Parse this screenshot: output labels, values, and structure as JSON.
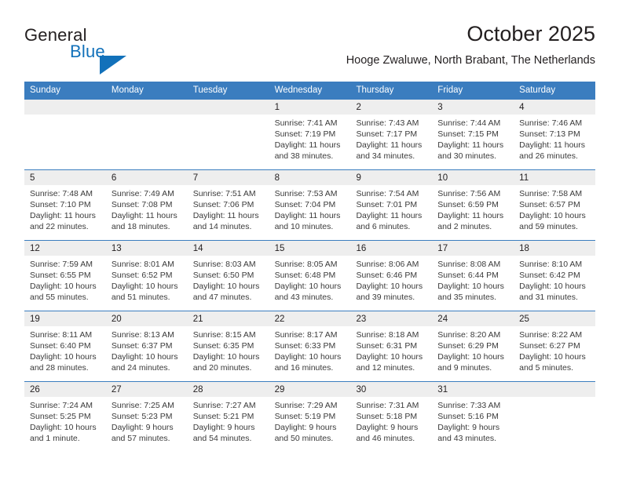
{
  "brand": {
    "word_one": "General",
    "word_two": "Blue",
    "triangle_color": "#1271ba",
    "text_color": "#231f20"
  },
  "header": {
    "month_title": "October 2025",
    "location": "Hooge Zwaluwe, North Brabant, The Netherlands"
  },
  "theme": {
    "header_blue": "#3b7dbf",
    "day_band_gray": "#eeeeee",
    "text_dark": "#231f20",
    "text_body": "#3a3a3a"
  },
  "weekdays": [
    "Sunday",
    "Monday",
    "Tuesday",
    "Wednesday",
    "Thursday",
    "Friday",
    "Saturday"
  ],
  "weeks": [
    [
      {
        "day": "",
        "sunrise": "",
        "sunset": "",
        "daylight_line1": "",
        "daylight_line2": ""
      },
      {
        "day": "",
        "sunrise": "",
        "sunset": "",
        "daylight_line1": "",
        "daylight_line2": ""
      },
      {
        "day": "",
        "sunrise": "",
        "sunset": "",
        "daylight_line1": "",
        "daylight_line2": ""
      },
      {
        "day": "1",
        "sunrise": "Sunrise: 7:41 AM",
        "sunset": "Sunset: 7:19 PM",
        "daylight_line1": "Daylight: 11 hours",
        "daylight_line2": "and 38 minutes."
      },
      {
        "day": "2",
        "sunrise": "Sunrise: 7:43 AM",
        "sunset": "Sunset: 7:17 PM",
        "daylight_line1": "Daylight: 11 hours",
        "daylight_line2": "and 34 minutes."
      },
      {
        "day": "3",
        "sunrise": "Sunrise: 7:44 AM",
        "sunset": "Sunset: 7:15 PM",
        "daylight_line1": "Daylight: 11 hours",
        "daylight_line2": "and 30 minutes."
      },
      {
        "day": "4",
        "sunrise": "Sunrise: 7:46 AM",
        "sunset": "Sunset: 7:13 PM",
        "daylight_line1": "Daylight: 11 hours",
        "daylight_line2": "and 26 minutes."
      }
    ],
    [
      {
        "day": "5",
        "sunrise": "Sunrise: 7:48 AM",
        "sunset": "Sunset: 7:10 PM",
        "daylight_line1": "Daylight: 11 hours",
        "daylight_line2": "and 22 minutes."
      },
      {
        "day": "6",
        "sunrise": "Sunrise: 7:49 AM",
        "sunset": "Sunset: 7:08 PM",
        "daylight_line1": "Daylight: 11 hours",
        "daylight_line2": "and 18 minutes."
      },
      {
        "day": "7",
        "sunrise": "Sunrise: 7:51 AM",
        "sunset": "Sunset: 7:06 PM",
        "daylight_line1": "Daylight: 11 hours",
        "daylight_line2": "and 14 minutes."
      },
      {
        "day": "8",
        "sunrise": "Sunrise: 7:53 AM",
        "sunset": "Sunset: 7:04 PM",
        "daylight_line1": "Daylight: 11 hours",
        "daylight_line2": "and 10 minutes."
      },
      {
        "day": "9",
        "sunrise": "Sunrise: 7:54 AM",
        "sunset": "Sunset: 7:01 PM",
        "daylight_line1": "Daylight: 11 hours",
        "daylight_line2": "and 6 minutes."
      },
      {
        "day": "10",
        "sunrise": "Sunrise: 7:56 AM",
        "sunset": "Sunset: 6:59 PM",
        "daylight_line1": "Daylight: 11 hours",
        "daylight_line2": "and 2 minutes."
      },
      {
        "day": "11",
        "sunrise": "Sunrise: 7:58 AM",
        "sunset": "Sunset: 6:57 PM",
        "daylight_line1": "Daylight: 10 hours",
        "daylight_line2": "and 59 minutes."
      }
    ],
    [
      {
        "day": "12",
        "sunrise": "Sunrise: 7:59 AM",
        "sunset": "Sunset: 6:55 PM",
        "daylight_line1": "Daylight: 10 hours",
        "daylight_line2": "and 55 minutes."
      },
      {
        "day": "13",
        "sunrise": "Sunrise: 8:01 AM",
        "sunset": "Sunset: 6:52 PM",
        "daylight_line1": "Daylight: 10 hours",
        "daylight_line2": "and 51 minutes."
      },
      {
        "day": "14",
        "sunrise": "Sunrise: 8:03 AM",
        "sunset": "Sunset: 6:50 PM",
        "daylight_line1": "Daylight: 10 hours",
        "daylight_line2": "and 47 minutes."
      },
      {
        "day": "15",
        "sunrise": "Sunrise: 8:05 AM",
        "sunset": "Sunset: 6:48 PM",
        "daylight_line1": "Daylight: 10 hours",
        "daylight_line2": "and 43 minutes."
      },
      {
        "day": "16",
        "sunrise": "Sunrise: 8:06 AM",
        "sunset": "Sunset: 6:46 PM",
        "daylight_line1": "Daylight: 10 hours",
        "daylight_line2": "and 39 minutes."
      },
      {
        "day": "17",
        "sunrise": "Sunrise: 8:08 AM",
        "sunset": "Sunset: 6:44 PM",
        "daylight_line1": "Daylight: 10 hours",
        "daylight_line2": "and 35 minutes."
      },
      {
        "day": "18",
        "sunrise": "Sunrise: 8:10 AM",
        "sunset": "Sunset: 6:42 PM",
        "daylight_line1": "Daylight: 10 hours",
        "daylight_line2": "and 31 minutes."
      }
    ],
    [
      {
        "day": "19",
        "sunrise": "Sunrise: 8:11 AM",
        "sunset": "Sunset: 6:40 PM",
        "daylight_line1": "Daylight: 10 hours",
        "daylight_line2": "and 28 minutes."
      },
      {
        "day": "20",
        "sunrise": "Sunrise: 8:13 AM",
        "sunset": "Sunset: 6:37 PM",
        "daylight_line1": "Daylight: 10 hours",
        "daylight_line2": "and 24 minutes."
      },
      {
        "day": "21",
        "sunrise": "Sunrise: 8:15 AM",
        "sunset": "Sunset: 6:35 PM",
        "daylight_line1": "Daylight: 10 hours",
        "daylight_line2": "and 20 minutes."
      },
      {
        "day": "22",
        "sunrise": "Sunrise: 8:17 AM",
        "sunset": "Sunset: 6:33 PM",
        "daylight_line1": "Daylight: 10 hours",
        "daylight_line2": "and 16 minutes."
      },
      {
        "day": "23",
        "sunrise": "Sunrise: 8:18 AM",
        "sunset": "Sunset: 6:31 PM",
        "daylight_line1": "Daylight: 10 hours",
        "daylight_line2": "and 12 minutes."
      },
      {
        "day": "24",
        "sunrise": "Sunrise: 8:20 AM",
        "sunset": "Sunset: 6:29 PM",
        "daylight_line1": "Daylight: 10 hours",
        "daylight_line2": "and 9 minutes."
      },
      {
        "day": "25",
        "sunrise": "Sunrise: 8:22 AM",
        "sunset": "Sunset: 6:27 PM",
        "daylight_line1": "Daylight: 10 hours",
        "daylight_line2": "and 5 minutes."
      }
    ],
    [
      {
        "day": "26",
        "sunrise": "Sunrise: 7:24 AM",
        "sunset": "Sunset: 5:25 PM",
        "daylight_line1": "Daylight: 10 hours",
        "daylight_line2": "and 1 minute."
      },
      {
        "day": "27",
        "sunrise": "Sunrise: 7:25 AM",
        "sunset": "Sunset: 5:23 PM",
        "daylight_line1": "Daylight: 9 hours",
        "daylight_line2": "and 57 minutes."
      },
      {
        "day": "28",
        "sunrise": "Sunrise: 7:27 AM",
        "sunset": "Sunset: 5:21 PM",
        "daylight_line1": "Daylight: 9 hours",
        "daylight_line2": "and 54 minutes."
      },
      {
        "day": "29",
        "sunrise": "Sunrise: 7:29 AM",
        "sunset": "Sunset: 5:19 PM",
        "daylight_line1": "Daylight: 9 hours",
        "daylight_line2": "and 50 minutes."
      },
      {
        "day": "30",
        "sunrise": "Sunrise: 7:31 AM",
        "sunset": "Sunset: 5:18 PM",
        "daylight_line1": "Daylight: 9 hours",
        "daylight_line2": "and 46 minutes."
      },
      {
        "day": "31",
        "sunrise": "Sunrise: 7:33 AM",
        "sunset": "Sunset: 5:16 PM",
        "daylight_line1": "Daylight: 9 hours",
        "daylight_line2": "and 43 minutes."
      },
      {
        "day": "",
        "sunrise": "",
        "sunset": "",
        "daylight_line1": "",
        "daylight_line2": ""
      }
    ]
  ]
}
